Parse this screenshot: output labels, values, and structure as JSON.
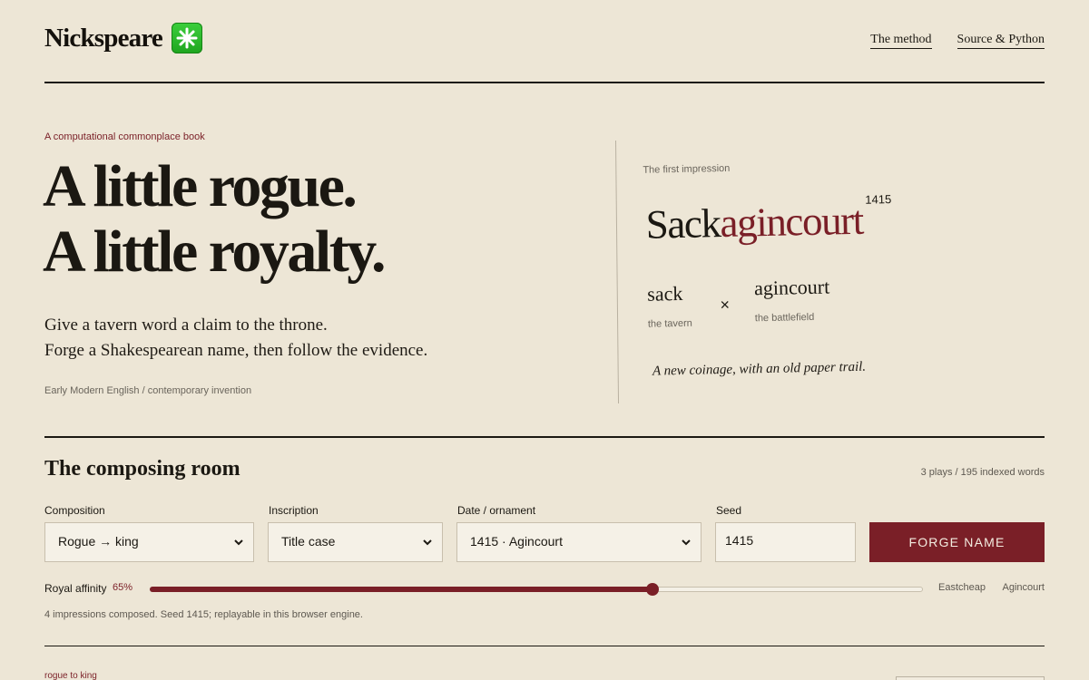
{
  "header": {
    "brand": "Nickspeare",
    "badge_icon": "eight-spoked-asterisk-icon",
    "nav": [
      "The method",
      "Source & Python"
    ]
  },
  "hero": {
    "eyebrow": "A computational commonplace book",
    "headline": [
      "A little rogue.",
      "A little royalty."
    ],
    "lede": [
      "Give a tavern word a claim to the throne.",
      "Forge a Shakespearean name, then follow the evidence."
    ],
    "meta": "Early Modern English / contemporary invention"
  },
  "impression": {
    "label": "The first impression",
    "name_part_a": "Sack",
    "name_part_b": "agincourt",
    "year": "1415",
    "word_a": "sack",
    "gloss_a": "the tavern",
    "operator": "×",
    "word_b": "agincourt",
    "gloss_b": "the battlefield",
    "tagline": "A new coinage, with an old paper trail."
  },
  "composer": {
    "title": "The composing room",
    "stats": "3 plays / 195 indexed words",
    "composition": {
      "label": "Composition",
      "value": "Rogue → king"
    },
    "inscription": {
      "label": "Inscription",
      "value": "Title case"
    },
    "date": {
      "label": "Date / ornament",
      "value": "1415 · Agincourt"
    },
    "seed": {
      "label": "Seed",
      "value": "1415"
    },
    "forge_label": "FORGE NAME",
    "affinity": {
      "label": "Royal affinity",
      "display": "65%",
      "value": 0.65,
      "min_label": "Eastcheap",
      "max_label": "Agincourt"
    },
    "status": "4 impressions composed. Seed 1415; replayable in this browser engine."
  },
  "next_entry": {
    "tag": "rogue to king"
  },
  "colors": {
    "accent": "#7a1f27",
    "background": "#ede6d6",
    "ink": "#1b1812",
    "badge": "#2bbb2b"
  }
}
